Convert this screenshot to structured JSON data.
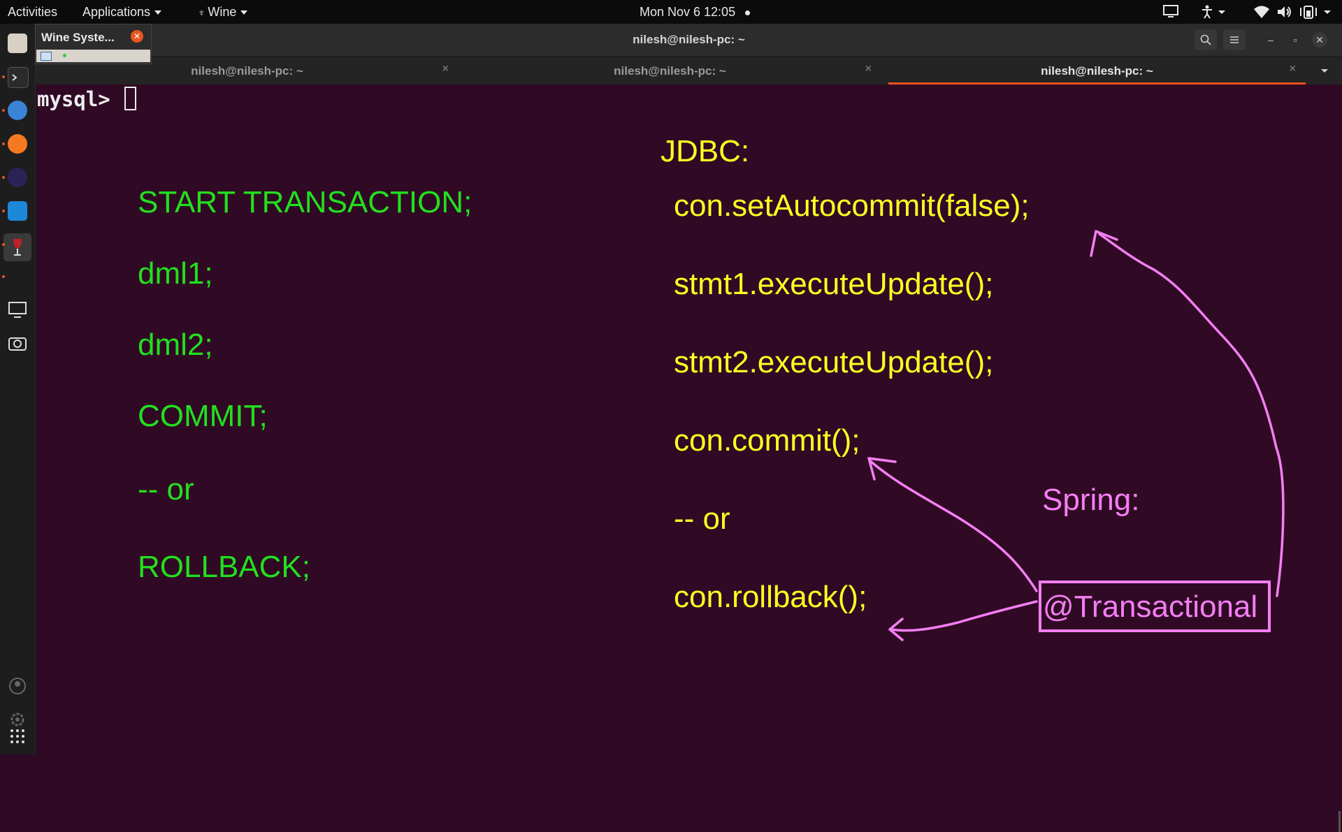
{
  "topbar": {
    "activities": "Activities",
    "applications": "Applications",
    "wine": "Wine",
    "clock": "Mon Nov 6  12:05"
  },
  "popup": {
    "title": "Wine Syste..."
  },
  "window": {
    "title": "nilesh@nilesh-pc: ~",
    "tabs": [
      {
        "label": "nilesh@nilesh-pc: ~",
        "active": false
      },
      {
        "label": "nilesh@nilesh-pc: ~",
        "active": false
      },
      {
        "label": "nilesh@nilesh-pc: ~",
        "active": true
      }
    ]
  },
  "terminal": {
    "prompt": "mysql>"
  },
  "sql_notes": [
    "START TRANSACTION;",
    "dml1;",
    "dml2;",
    "COMMIT;",
    "-- or",
    "ROLLBACK;"
  ],
  "jdbc": {
    "heading": "JDBC:",
    "lines": [
      "con.setAutocommit(false);",
      "stmt1.executeUpdate();",
      "stmt2.executeUpdate();",
      "con.commit();",
      "-- or",
      "con.rollback();"
    ]
  },
  "spring": {
    "heading": "Spring:",
    "annotation": "@Transactional"
  },
  "colors": {
    "terminal_bg": "#300a24",
    "sql_text": "#22e01e",
    "jdbc_text": "#ffff22",
    "spring_ink": "#f47ef4",
    "accent": "#e95420"
  }
}
